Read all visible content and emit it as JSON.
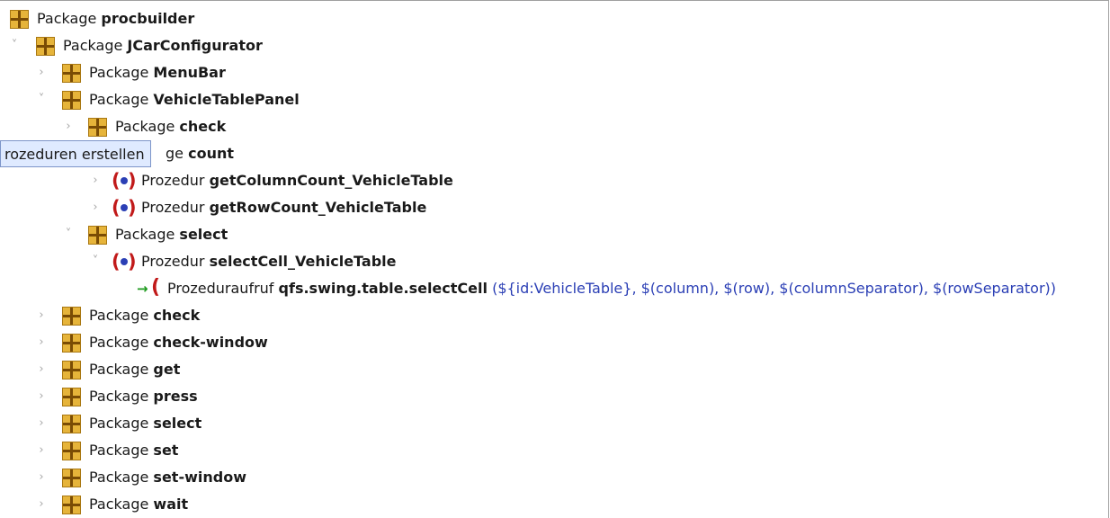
{
  "tree": {
    "rows": [
      {
        "kind": "Package",
        "name": "procbuilder",
        "expander": ""
      },
      {
        "kind": "Package",
        "name": "JCarConfigurator",
        "expander": "˅"
      },
      {
        "kind": "Package",
        "name": "MenuBar",
        "expander": "›"
      },
      {
        "kind": "Package",
        "name": "VehicleTablePanel",
        "expander": "˅"
      },
      {
        "kind": "Package",
        "name": "check",
        "expander": "›"
      },
      {
        "kind": "Package",
        "name": "count",
        "expander": "˅",
        "visible_text": "ge count"
      },
      {
        "kind": "Prozedur",
        "name": "getColumnCount_VehicleTable",
        "expander": "›"
      },
      {
        "kind": "Prozedur",
        "name": "getRowCount_VehicleTable",
        "expander": "›"
      },
      {
        "kind": "Package",
        "name": "select",
        "expander": "˅"
      },
      {
        "kind": "Prozedur",
        "name": "selectCell_VehicleTable",
        "expander": "˅"
      },
      {
        "kind": "Prozeduraufruf",
        "name": "qfs.swing.table.selectCell",
        "expander": "",
        "args": "(${id:VehicleTable}, $(column), $(row), $(columnSeparator), $(rowSeparator))"
      },
      {
        "kind": "Package",
        "name": "check",
        "expander": "›"
      },
      {
        "kind": "Package",
        "name": "check-window",
        "expander": "›"
      },
      {
        "kind": "Package",
        "name": "get",
        "expander": "›"
      },
      {
        "kind": "Package",
        "name": "press",
        "expander": "›"
      },
      {
        "kind": "Package",
        "name": "select",
        "expander": "›"
      },
      {
        "kind": "Package",
        "name": "set",
        "expander": "›"
      },
      {
        "kind": "Package",
        "name": "set-window",
        "expander": "›"
      },
      {
        "kind": "Package",
        "name": "wait",
        "expander": "›"
      }
    ]
  },
  "tooltip": {
    "text": "rozeduren erstellen"
  },
  "icons": {
    "package": "package-icon",
    "procedure": "procedure-icon",
    "procedure_call": "procedure-call-icon"
  },
  "colors": {
    "package_icon": "#e6b43a",
    "procedure_paren": "#c11a1a",
    "procedure_dot": "#2b3fb5",
    "call_arrow": "#1d9a1d",
    "args_text": "#2b3fb5",
    "tooltip_bg": "#dfeaff"
  }
}
